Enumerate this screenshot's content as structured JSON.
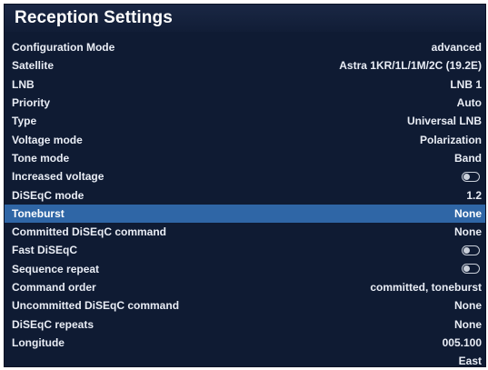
{
  "title": "Reception Settings",
  "rows": [
    {
      "label": "Configuration Mode",
      "value": "advanced"
    },
    {
      "label": "Satellite",
      "value": "Astra 1KR/1L/1M/2C (19.2E)"
    },
    {
      "label": "LNB",
      "value": "LNB 1"
    },
    {
      "label": "Priority",
      "value": "Auto"
    },
    {
      "label": "Type",
      "value": "Universal LNB"
    },
    {
      "label": "Voltage mode",
      "value": "Polarization"
    },
    {
      "label": "Tone mode",
      "value": "Band"
    },
    {
      "label": "Increased voltage",
      "value": "",
      "toggle": "off"
    },
    {
      "label": "DiSEqC mode",
      "value": "1.2"
    },
    {
      "label": "Toneburst",
      "value": "None",
      "selected": true
    },
    {
      "label": "Committed DiSEqC command",
      "value": "None"
    },
    {
      "label": "Fast DiSEqC",
      "value": "",
      "toggle": "off"
    },
    {
      "label": "Sequence repeat",
      "value": "",
      "toggle": "off"
    },
    {
      "label": "Command order",
      "value": "committed, toneburst"
    },
    {
      "label": "Uncommitted DiSEqC command",
      "value": "None"
    },
    {
      "label": "DiSEqC repeats",
      "value": "None"
    },
    {
      "label": "Longitude",
      "value": "005.100"
    },
    {
      "label": "",
      "value": "East"
    }
  ],
  "colors": {
    "background": "#0f1b33",
    "selected_row": "#2f66a6",
    "text": "#e9edf5"
  }
}
